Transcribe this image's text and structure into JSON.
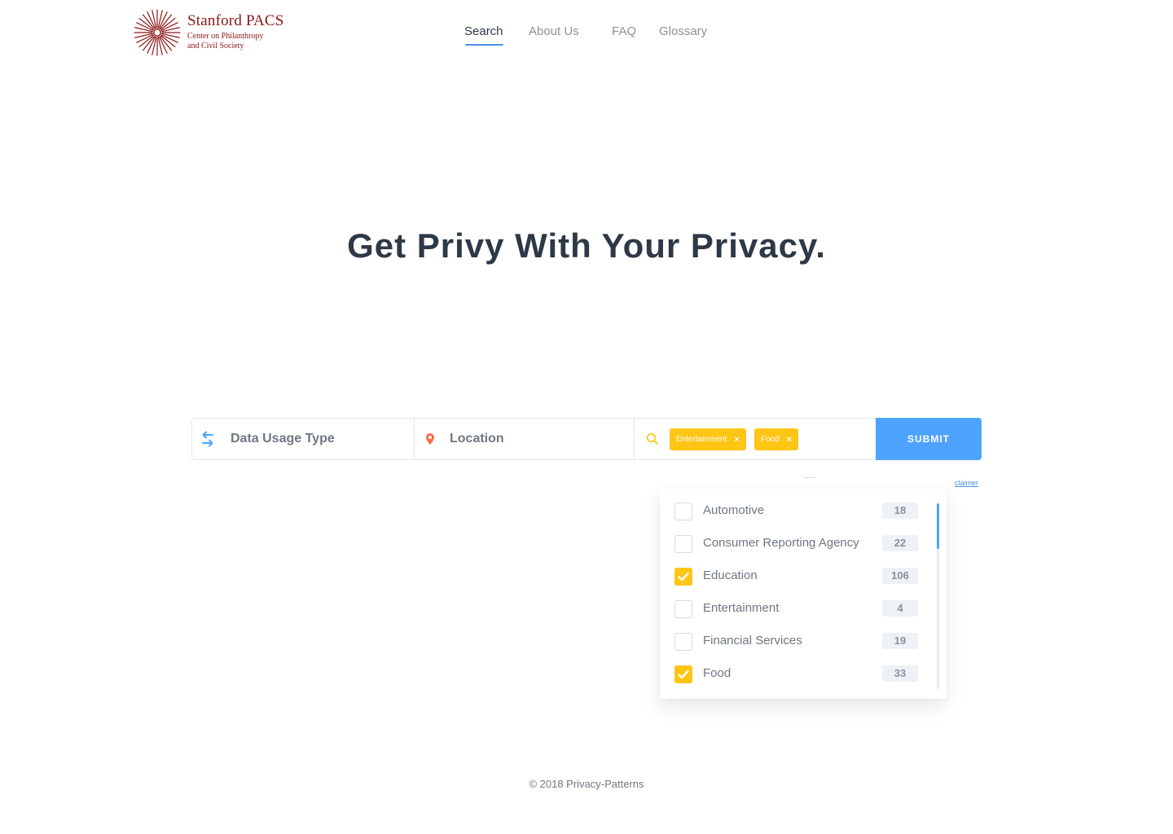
{
  "brand": {
    "title": "Stanford PACS",
    "subtitle_line1": "Center on Philanthropy",
    "subtitle_line2": "and Civil Society",
    "color": "#8c1515",
    "icon": "sunburst-logo-icon"
  },
  "nav": {
    "items": [
      {
        "label": "Search",
        "active": true
      },
      {
        "label": "About Us",
        "active": false
      },
      {
        "label": "FAQ",
        "active": false
      },
      {
        "label": "Glossary",
        "active": false
      }
    ],
    "accent": "#4a90e2"
  },
  "hero": {
    "title": "Get Privy With Your Privacy."
  },
  "search": {
    "usage_placeholder": "Data Usage Type",
    "usage_icon": "swap-arrows-icon",
    "location_placeholder": "Location",
    "location_icon": "map-pin-icon",
    "industry_icon": "search-icon",
    "tags": [
      {
        "label": "Entertainment"
      },
      {
        "label": "Food"
      }
    ],
    "submit_label": "SUBMIT",
    "tag_color": "#fec515",
    "submit_color": "#4da3ff"
  },
  "disclaimer": "claimer",
  "dropdown": {
    "items": [
      {
        "label": "Automotive",
        "count": "18",
        "checked": false
      },
      {
        "label": "Consumer Reporting Agency",
        "count": "22",
        "checked": false
      },
      {
        "label": "Education",
        "count": "106",
        "checked": true
      },
      {
        "label": "Entertainment",
        "count": "4",
        "checked": false
      },
      {
        "label": "Financial Services",
        "count": "19",
        "checked": false
      },
      {
        "label": "Food",
        "count": "33",
        "checked": true
      }
    ]
  },
  "footer": {
    "text": "© 2018 Privacy-Patterns"
  }
}
